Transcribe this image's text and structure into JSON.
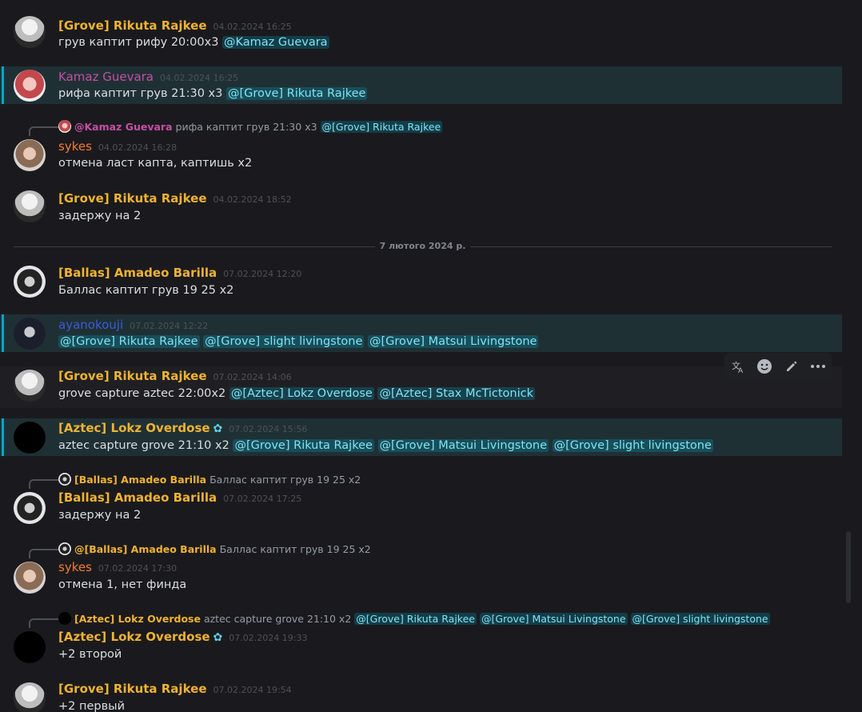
{
  "messages": [
    {
      "author": "[Grove] Rikuta Rajkee",
      "timestamp": "04.02.2024 16:25",
      "text": "грув каптит рифу 20:00x3",
      "mentions": [
        "@Kamaz Guevara"
      ]
    },
    {
      "author": "Kamaz Guevara",
      "timestamp": "04.02.2024 16:25",
      "text": "рифа каптит грув 21:30 x3",
      "mentions": [
        "@[Grove] Rikuta Rajkee"
      ]
    },
    {
      "reply_author": "@Kamaz Guevara",
      "reply_text": "рифа каптит грув 21:30 x3",
      "reply_mention": "@[Grove] Rikuta Rajkee",
      "author": "sykes",
      "timestamp": "04.02.2024 16:28",
      "text": "отмена ласт капта, каптишь x2"
    },
    {
      "author": "[Grove] Rikuta Rajkee",
      "timestamp": "04.02.2024 18:52",
      "text": "задержу на 2"
    },
    {
      "author": "[Ballas] Amadeo Barilla",
      "timestamp": "07.02.2024 12:20",
      "text": "Баллас каптит грув 19 25 x2"
    },
    {
      "author": "ayanokouji",
      "timestamp": "07.02.2024 12:22",
      "mentions": [
        "@[Grove] Rikuta Rajkee",
        "@[Grove] slight livingstone",
        "@[Grove] Matsui Livingstone"
      ]
    },
    {
      "author": "[Grove] Rikuta Rajkee",
      "timestamp": "07.02.2024 14:06",
      "text": "grove capture aztec 22:00x2",
      "mentions": [
        "@[Aztec] Lokz Overdose",
        "@[Aztec] Stax McTictonick"
      ]
    },
    {
      "author": "[Aztec] Lokz Overdose",
      "timestamp": "07.02.2024 15:56",
      "text": "aztec capture grove 21:10 x2",
      "mentions": [
        "@[Grove] Rikuta Rajkee",
        "@[Grove] Matsui Livingstone",
        "@[Grove] slight livingstone"
      ]
    },
    {
      "reply_author": "[Ballas] Amadeo Barilla",
      "reply_text": "Баллас каптит грув 19 25 x2",
      "author": "[Ballas] Amadeo Barilla",
      "timestamp": "07.02.2024 17:25",
      "text": "задержу на 2"
    },
    {
      "reply_author": "@[Ballas] Amadeo Barilla",
      "reply_text": "Баллас каптит грув 19 25 x2",
      "author": "sykes",
      "timestamp": "07.02.2024 17:30",
      "text": "отмена 1, нет финда"
    },
    {
      "reply_author": "[Aztec] Lokz Overdose",
      "reply_text": "aztec capture grove 21:10 x2",
      "reply_mentions": [
        "@[Grove] Rikuta Rajkee",
        "@[Grove] Matsui Livingstone",
        "@[Grove] slight livingstone"
      ],
      "author": "[Aztec] Lokz Overdose",
      "timestamp": "07.02.2024 19:33",
      "text": "+2 второй"
    },
    {
      "author": "[Grove] Rikuta Rajkee",
      "timestamp": "07.02.2024 19:54",
      "text": "+2 первый"
    }
  ],
  "date_divider": "7 лютого 2024 р.",
  "toolbar": {
    "icons": [
      "translate-icon",
      "emoji-icon",
      "edit-icon",
      "more-icon"
    ]
  },
  "colors": {
    "background": "#1a1a1e",
    "mention_highlight": "#1f3035",
    "grove_role": "#f0b232",
    "kamaz_role": "#c54fa4",
    "sykes_role": "#f47b32",
    "ayanokouji_role": "#3c5bd6"
  }
}
